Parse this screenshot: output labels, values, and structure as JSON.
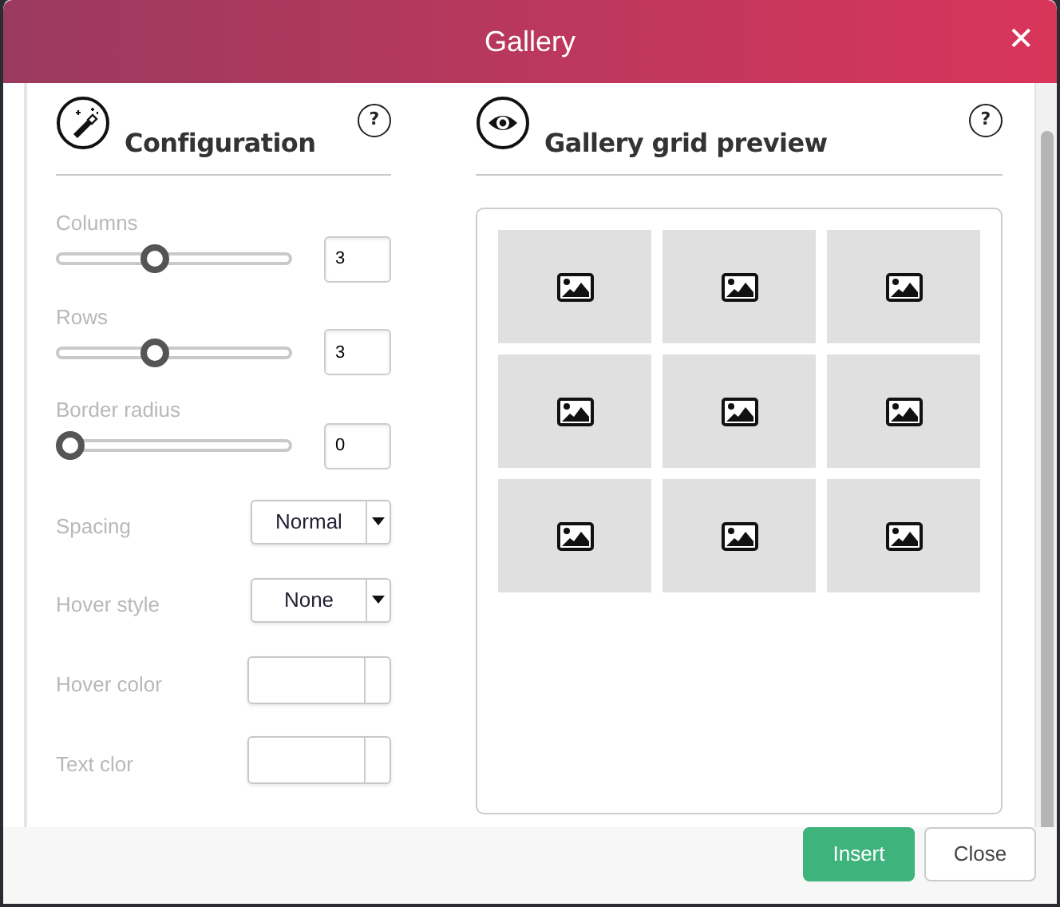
{
  "window": {
    "title": "Gallery",
    "close_symbol": "✕"
  },
  "configuration": {
    "title": "Configuration",
    "help": "?",
    "fields": [
      {
        "kind": "slider",
        "label": "Columns",
        "level": 0.42,
        "value": "3"
      },
      {
        "kind": "slider",
        "label": "Rows",
        "level": 0.42,
        "value": "3"
      },
      {
        "kind": "slider",
        "label": "Border radius",
        "level": 0,
        "value": "0"
      },
      {
        "kind": "select",
        "label": "Spacing",
        "value": "Normal"
      },
      {
        "kind": "select",
        "label": "Hover style",
        "value": "None"
      },
      {
        "kind": "color",
        "label": "Hover color"
      },
      {
        "kind": "color",
        "label": "Text clor"
      }
    ]
  },
  "preview": {
    "title": "Gallery grid preview",
    "help": "?",
    "rows": [
      [
        {
          "kind": "image"
        },
        {
          "kind": "image"
        },
        {
          "kind": "image"
        }
      ],
      [
        {
          "kind": "image"
        },
        {
          "kind": "image"
        },
        {
          "kind": "image"
        }
      ],
      [
        {
          "kind": "image"
        },
        {
          "kind": "image"
        },
        {
          "kind": "image"
        }
      ]
    ]
  },
  "buttons": [
    {
      "label": "Insert",
      "kind": "primary"
    },
    {
      "label": "Close",
      "kind": "secondary"
    }
  ]
}
